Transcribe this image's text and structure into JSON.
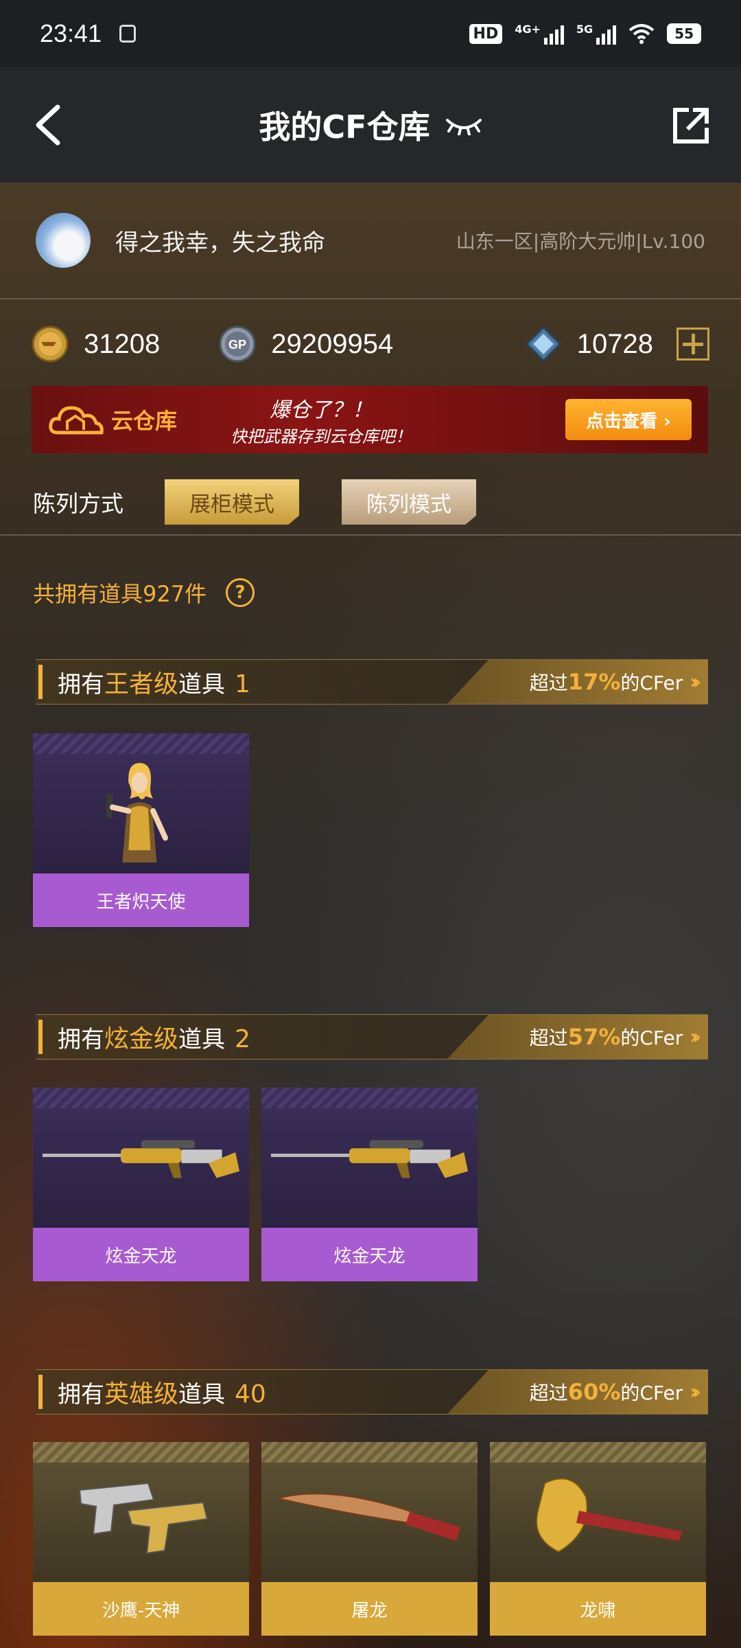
{
  "status_bar": {
    "time": "23:41",
    "hd_label": "HD",
    "net1_label": "4G+",
    "net2_label": "5G",
    "battery": "55"
  },
  "nav": {
    "title": "我的CF仓库"
  },
  "profile": {
    "nickname": "得之我幸，失之我命",
    "server_info": "山东一区|高阶大元帅|Lv.100"
  },
  "currency": {
    "cf_points": "31208",
    "gp_label": "GP",
    "gp": "29209954",
    "diamonds": "10728"
  },
  "banner": {
    "logo_text": "云仓库",
    "slogan_line1": "爆仓了？！",
    "slogan_line2": "快把武器存到云仓库吧！",
    "button_label": "点击查看 ›"
  },
  "display": {
    "label": "陈列方式",
    "mode_cabinet": "展柜模式",
    "mode_list": "陈列模式"
  },
  "total": {
    "text": "共拥有道具927件",
    "help_symbol": "?"
  },
  "tiers": [
    {
      "prefix": "拥有",
      "tier_name": "王者级",
      "suffix": "道具",
      "count": "1",
      "rank_prefix": "超过",
      "rank_pct": "17%",
      "rank_suffix": "的CFer",
      "items": [
        "王者炽天使"
      ]
    },
    {
      "prefix": "拥有",
      "tier_name": "炫金级",
      "suffix": "道具",
      "count": "2",
      "rank_prefix": "超过",
      "rank_pct": "57%",
      "rank_suffix": "的CFer",
      "items": [
        "炫金天龙",
        "炫金天龙"
      ]
    },
    {
      "prefix": "拥有",
      "tier_name": "英雄级",
      "suffix": "道具",
      "count": "40",
      "rank_prefix": "超过",
      "rank_pct": "60%",
      "rank_suffix": "的CFer",
      "items": [
        "沙鹰-天神",
        "屠龙",
        "龙啸"
      ]
    }
  ],
  "colors": {
    "accent_gold": "#f3b13c",
    "legend_purple": "#a85bd0",
    "hero_gold": "#d9a83a",
    "banner_red": "#8b1414",
    "button_orange": "#f7a21f"
  }
}
